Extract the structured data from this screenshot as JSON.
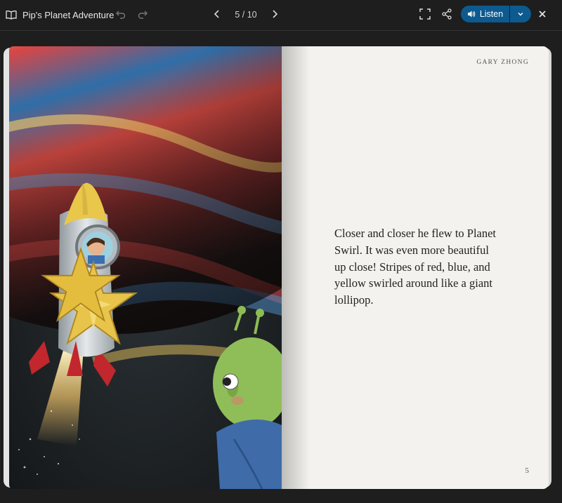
{
  "header": {
    "book_title": "Pip's Planet Adventure",
    "book_icon": "open-book-icon",
    "undo_icon": "undo-icon",
    "redo_icon": "redo-icon",
    "prev_icon": "chevron-left-icon",
    "next_icon": "chevron-right-icon",
    "page_indicator": "5 / 10",
    "fullscreen_icon": "fullscreen-icon",
    "share_icon": "share-icon",
    "listen_label": "Listen",
    "listen_icon": "speaker-icon",
    "listen_menu_icon": "chevron-down-icon",
    "close_icon": "close-icon"
  },
  "book": {
    "illustration": "rocket-and-alien-illustration",
    "author": "GARY ZHONG",
    "text": "Closer and closer he flew to Planet Swirl. It was even more beautiful up close! Stripes of red, blue, and yellow swirled around like a giant lollipop.",
    "page_number": "5"
  },
  "colors": {
    "background": "#1e1e1e",
    "accent": "#0d5a8f",
    "page": "#f3f2ef"
  }
}
